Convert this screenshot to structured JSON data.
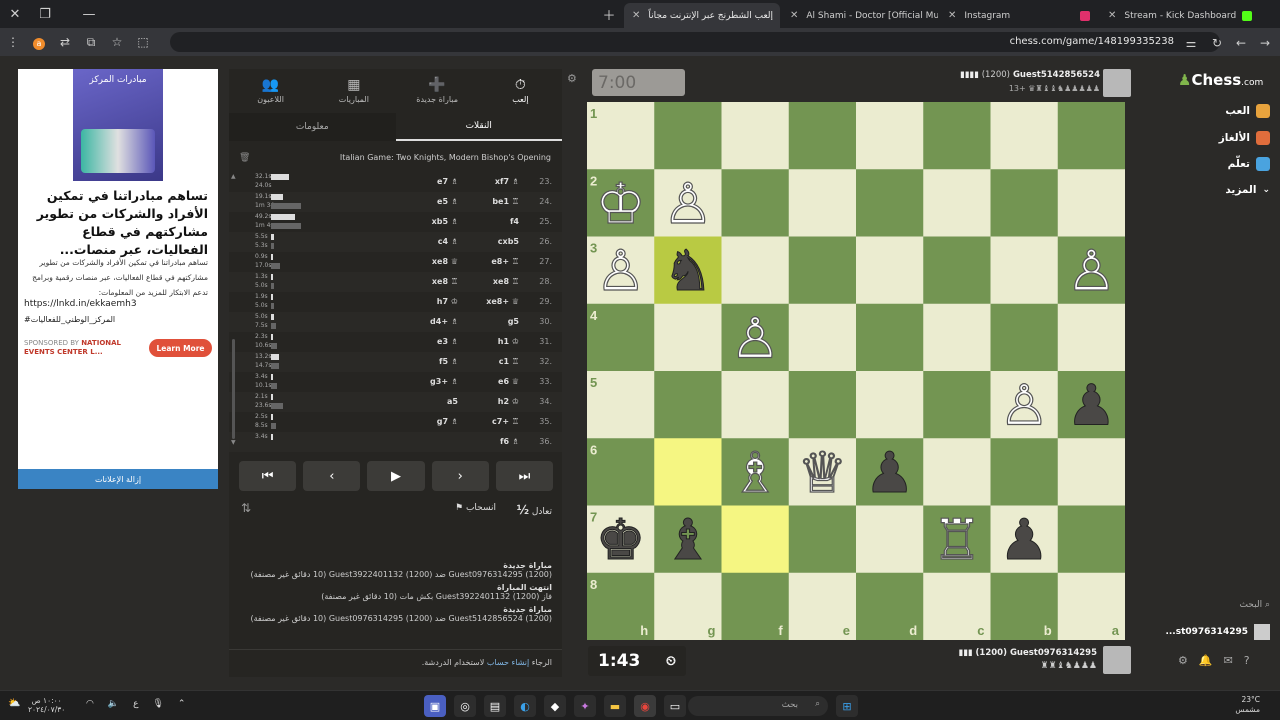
{
  "browser": {
    "tabs": [
      {
        "label": "Stream - Kick Dashboard",
        "color": "#53fc18"
      },
      {
        "label": "Instagram",
        "color": "#e1306c"
      },
      {
        "label": "Al Shami - Doctor [Official Mus",
        "color": "#ff0000"
      },
      {
        "label": "إلعب الشطرنج عبر الإنترنت مجاناً",
        "color": "#81b64c"
      }
    ],
    "url": "chess.com/game/148199335238",
    "profile_initial": "a"
  },
  "ad": {
    "image_title": "مبادرات المركز",
    "headline": "تساهم مبادراتنا في تمكين الأفراد والشركات من تطوير مشاركتهم في قطاع الفعاليات، عبر منصات...",
    "body": "تساهم مبادراتنا في تمكين الأفراد والشركات من تطوير مشاركتهم في قطاع الفعاليات، عبر منصات رقمية وبرامج تدعم الابتكار للمزيد من المعلومات:",
    "link": "https://lnkd.in/ekkaemh3",
    "hashtag": "#المركز_الوطني_للفعاليات",
    "sponsor_prefix": "SPONSORED BY",
    "sponsor_name": "NATIONAL EVENTS CENTER L...",
    "cta": "Learn More",
    "remove": "إزالة الإعلانات"
  },
  "panel": {
    "tabs": [
      {
        "label": "إلعب",
        "icon": "stopwatch-icon",
        "glyph": "⏱"
      },
      {
        "label": "مباراة جديدة",
        "icon": "plus-icon",
        "glyph": "➕"
      },
      {
        "label": "المباريات",
        "icon": "board-icon",
        "glyph": "▦"
      },
      {
        "label": "اللاعبون",
        "icon": "players-icon",
        "glyph": "👥"
      }
    ],
    "subtabs": [
      "النقلات",
      "معلومات"
    ],
    "opening": "Italian Game: Two Knights, Modern Bishop's Opening",
    "moves": [
      {
        "num": "23.",
        "white": "xf7 ♗",
        "black": "e7 ♗",
        "tw": "32.1s",
        "tb": "24.0s",
        "bw": 12,
        "bb": 0
      },
      {
        "num": "24.",
        "white": "be1 ♖",
        "black": "e5 ♗",
        "tw": "19.1s",
        "tb": "1m 34s",
        "bw": 8,
        "bb": 20
      },
      {
        "num": "25.",
        "white": "f4",
        "black": "xb5 ♗",
        "tw": "49.2s",
        "tb": "1m 4s",
        "bw": 16,
        "bb": 20
      },
      {
        "num": "26.",
        "white": "cxb5",
        "black": "c4 ♗",
        "tw": "5.5s",
        "tb": "5.3s",
        "bw": 2,
        "bb": 2
      },
      {
        "num": "27.",
        "white": "e8+ ♖",
        "black": "xe8 ♕",
        "tw": "0.9s",
        "tb": "17.0s",
        "bw": 1,
        "bb": 6
      },
      {
        "num": "28.",
        "white": "xe8 ♖",
        "black": "xe8 ♖",
        "tw": "1.3s",
        "tb": "5.0s",
        "bw": 1,
        "bb": 2
      },
      {
        "num": "29.",
        "white": "xe8+ ♕",
        "black": "h7 ♔",
        "tw": "1.9s",
        "tb": "5.0s",
        "bw": 1,
        "bb": 2
      },
      {
        "num": "30.",
        "white": "g5",
        "black": "d4+ ♗",
        "tw": "5.0s",
        "tb": "7.5s",
        "bw": 2,
        "bb": 3
      },
      {
        "num": "31.",
        "white": "h1 ♔",
        "black": "e3 ♗",
        "tw": "2.3s",
        "tb": "10.6s",
        "bw": 1,
        "bb": 4
      },
      {
        "num": "32.",
        "white": "c1 ♖",
        "black": "f5 ♗",
        "tw": "13.2s",
        "tb": "14.7s",
        "bw": 5,
        "bb": 5
      },
      {
        "num": "33.",
        "white": "e6 ♕",
        "black": "g3+ ♗",
        "tw": "3.4s",
        "tb": "10.1s",
        "bw": 1,
        "bb": 4
      },
      {
        "num": "34.",
        "white": "h2 ♔",
        "black": "a5",
        "tw": "2.1s",
        "tb": "23.6s",
        "bw": 1,
        "bb": 8
      },
      {
        "num": "35.",
        "white": "c7+ ♖",
        "black": "g7 ♗",
        "tw": "2.5s",
        "tb": "8.5s",
        "bw": 1,
        "bb": 3
      },
      {
        "num": "36.",
        "white": "f6 ♗",
        "black": "",
        "tw": "3.4s",
        "tb": "",
        "bw": 1,
        "bb": 0
      }
    ],
    "nav": [
      "⏮",
      "‹",
      "▶",
      "›",
      "⏭"
    ],
    "draw": "تعادل",
    "resign": "انسحاب",
    "half": "½",
    "log": [
      {
        "title": "مباراة جديدة",
        "text": "Guest0976314295 (1200) ضد Guest3922401132 (1200) (10 دقائق غير مصنفة)"
      },
      {
        "title": "انتهت المباراة",
        "text": "فاز Guest3922401132 (1200) بكش مات (10 دقائق غير مصنفة)"
      },
      {
        "title": "مباراة جديدة",
        "text": "Guest5142856524 (1200) ضد Guest0976314295 (1200) (10 دقائق غير مصنفة)"
      }
    ],
    "chat_prefix": "الرجاء",
    "chat_link": "إنشاء حساب",
    "chat_suffix": "لاستخدام الدردشة."
  },
  "top_player": {
    "name": "Guest5142856524",
    "rating": "(1200)",
    "clock": "7:00",
    "captured": "13+ ♛♜♝♝♞♟♟♟♟♟"
  },
  "bottom_player": {
    "name": "Guest0976314295",
    "rating": "(1200)",
    "clock": "1:43",
    "captured": "♜♜♝♞♟♟♟"
  },
  "board": {
    "light": "#ebecd0",
    "dark": "#739552",
    "highlight_light": "#f5f682",
    "highlight_dark": "#b9ca43",
    "ranks": [
      "1",
      "2",
      "3",
      "4",
      "5",
      "6",
      "7",
      "8"
    ],
    "files": [
      "h",
      "g",
      "f",
      "e",
      "d",
      "c",
      "b",
      "a"
    ],
    "highlights": [
      [
        2,
        1
      ],
      [
        5,
        1
      ],
      [
        6,
        2
      ]
    ],
    "pieces": [
      {
        "r": 1,
        "c": 0,
        "p": "♔",
        "color": "w"
      },
      {
        "r": 1,
        "c": 1,
        "p": "♙",
        "color": "w"
      },
      {
        "r": 2,
        "c": 0,
        "p": "♙",
        "color": "w"
      },
      {
        "r": 2,
        "c": 1,
        "p": "♞",
        "color": "b"
      },
      {
        "r": 2,
        "c": 7,
        "p": "♙",
        "color": "w"
      },
      {
        "r": 3,
        "c": 2,
        "p": "♙",
        "color": "w"
      },
      {
        "r": 4,
        "c": 6,
        "p": "♙",
        "color": "w"
      },
      {
        "r": 4,
        "c": 7,
        "p": "♟",
        "color": "b"
      },
      {
        "r": 5,
        "c": 2,
        "p": "♗",
        "color": "w"
      },
      {
        "r": 5,
        "c": 3,
        "p": "♕",
        "color": "w"
      },
      {
        "r": 5,
        "c": 4,
        "p": "♟",
        "color": "b"
      },
      {
        "r": 6,
        "c": 0,
        "p": "♚",
        "color": "b"
      },
      {
        "r": 6,
        "c": 1,
        "p": "♝",
        "color": "b"
      },
      {
        "r": 6,
        "c": 5,
        "p": "♖",
        "color": "w"
      },
      {
        "r": 6,
        "c": 6,
        "p": "♟",
        "color": "b"
      }
    ]
  },
  "rightnav": {
    "logo": "Chess",
    "logo_suffix": ".com",
    "items": [
      {
        "label": "العب",
        "color": "#e8a33d"
      },
      {
        "label": "الألغاز",
        "color": "#e06d3c"
      },
      {
        "label": "تعلّم",
        "color": "#4aa3df"
      },
      {
        "label": "المزيد",
        "color": "#888"
      }
    ],
    "search": "البحث",
    "friend": "...st0976314295"
  },
  "taskbar": {
    "time": "١٠:٠٠ ص",
    "date": "٢٠٢٤/٠٧/٣٠",
    "lang": "ع",
    "search": "بحث",
    "temp": "23°C",
    "weather": "مشمس"
  }
}
